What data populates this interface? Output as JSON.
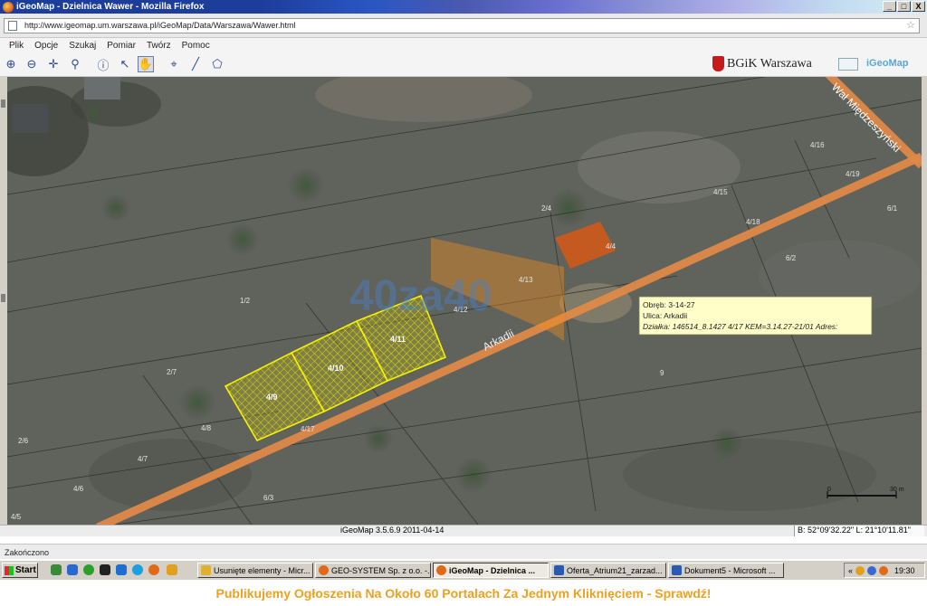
{
  "window": {
    "title": "iGeoMap - Dzielnica Wawer - Mozilla Firefox",
    "minimize": "_",
    "maximize": "□",
    "close": "X"
  },
  "browser": {
    "url": "http://www.igeomap.um.warszawa.pl/iGeoMap/Data/Warszawa/Wawer.html",
    "bookmark_star": "☆"
  },
  "menu": [
    "Plik",
    "Opcje",
    "Szukaj",
    "Pomiar",
    "Twórz",
    "Pomoc"
  ],
  "toolbar": {
    "tools": [
      {
        "name": "zoom-in",
        "glyph": "⊕"
      },
      {
        "name": "zoom-out",
        "glyph": "⊖"
      },
      {
        "name": "pan",
        "glyph": "✛"
      },
      {
        "name": "zoom-search",
        "glyph": "⚲"
      },
      {
        "name": "info",
        "glyph": "ⓘ"
      },
      {
        "name": "select-arrow",
        "glyph": "↖"
      },
      {
        "name": "hand",
        "glyph": "✋"
      },
      {
        "name": "target",
        "glyph": "⌖"
      },
      {
        "name": "measure-line",
        "glyph": "╱"
      },
      {
        "name": "measure-area",
        "glyph": "⬠"
      }
    ],
    "brand_left": "BGiK Warszawa",
    "brand_right": "iGeoMap"
  },
  "map": {
    "parcel_labels": [
      "4/9",
      "4/10",
      "4/11"
    ],
    "other_labels": [
      "4/16",
      "4/19",
      "4/15",
      "6/1",
      "4/18",
      "6/2",
      "4/4",
      "2/4",
      "4/13",
      "4/12",
      "1/2",
      "2/7",
      "4/8",
      "4/17",
      "2/6",
      "4/7",
      "4/6",
      "6/3",
      "4/5",
      "9"
    ],
    "street_main": "Arkadii",
    "street_cross": "Wał Międzeszyński",
    "watermark": "40za40",
    "scale_label_left": "0",
    "scale_label_right": "30 m",
    "popup": {
      "line1": "Obręb: 3-14-27",
      "line2": "Ulica: Arkadii",
      "line3": "Działka: 146514_8.1427 4/17 KEM=3.14.27-21/01 Adres:"
    },
    "colors": {
      "parcel": "#f6f200",
      "road": "#e08a48",
      "highlight": "#f08c1c",
      "popup_bg": "#fffec8"
    }
  },
  "status": {
    "version": "iGeoMap 3.5.6.9 2011-04-14",
    "coords": "B: 52°09'32.22\" L: 21°10'11.81\"",
    "page_state": "Zakończono"
  },
  "taskbar": {
    "start": "Start",
    "tasks": [
      "Usunięte elementy - Micr...",
      "GEO-SYSTEM Sp. z o.o. -...",
      "iGeoMap - Dzielnica ...",
      "Oferta_Atrium21_zarzad...",
      "Dokument5 - Microsoft ..."
    ],
    "tray_arrow": "«",
    "clock": "19:30"
  },
  "ad_banner": "Publikujemy Ogłoszenia Na Około 60 Portalach Za Jednym Kliknięciem - Sprawdź!"
}
